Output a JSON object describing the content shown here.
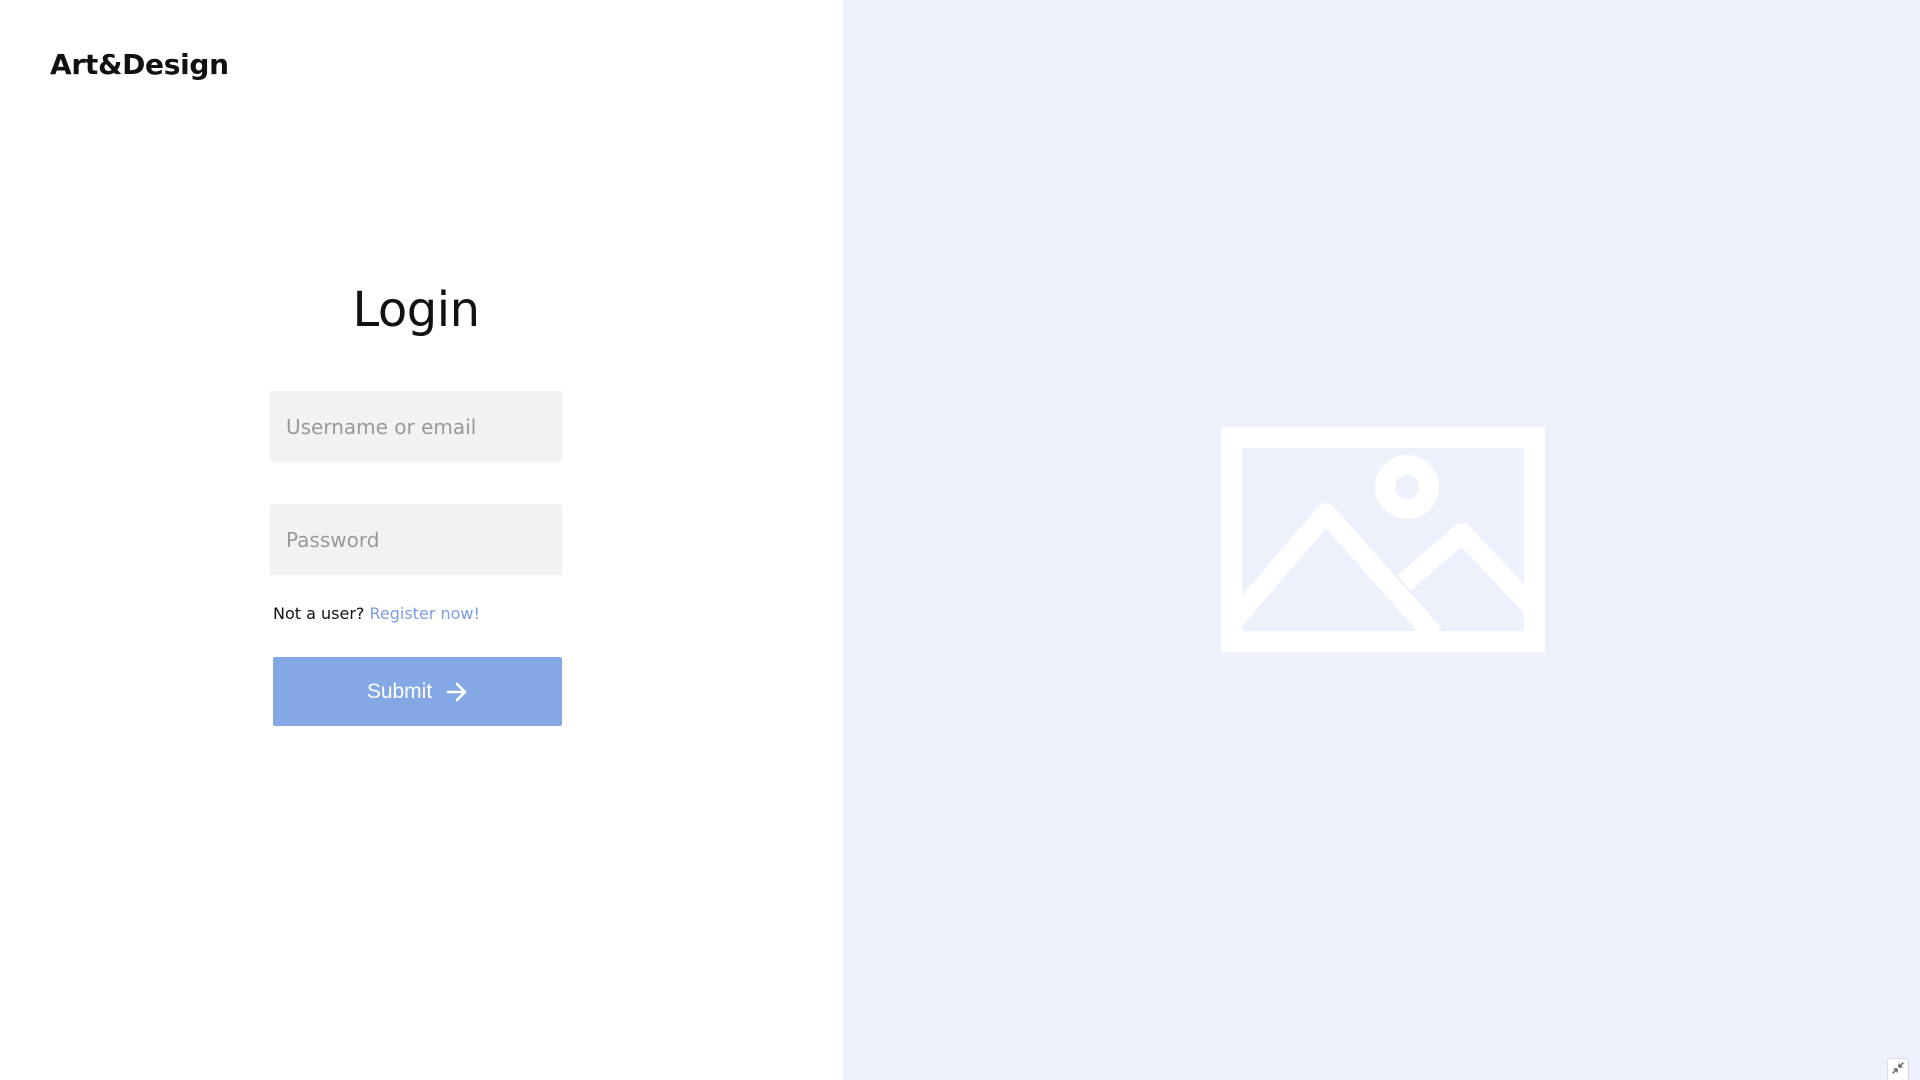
{
  "brand": {
    "name": "Art&Design"
  },
  "login": {
    "title": "Login",
    "username_placeholder": "Username or email",
    "password_placeholder": "Password",
    "register_prompt": "Not a user?",
    "register_link": "Register now!",
    "submit_label": "Submit",
    "submit_icon": "arrow-right-icon"
  },
  "hero": {
    "icon": "image-placeholder-icon"
  },
  "corner": {
    "icon": "collapse-icon"
  },
  "colors": {
    "accent": "#84a8e4",
    "link": "#7a9ee0",
    "panel_bg": "#edf1fc",
    "field_bg": "#f2f2f2"
  }
}
